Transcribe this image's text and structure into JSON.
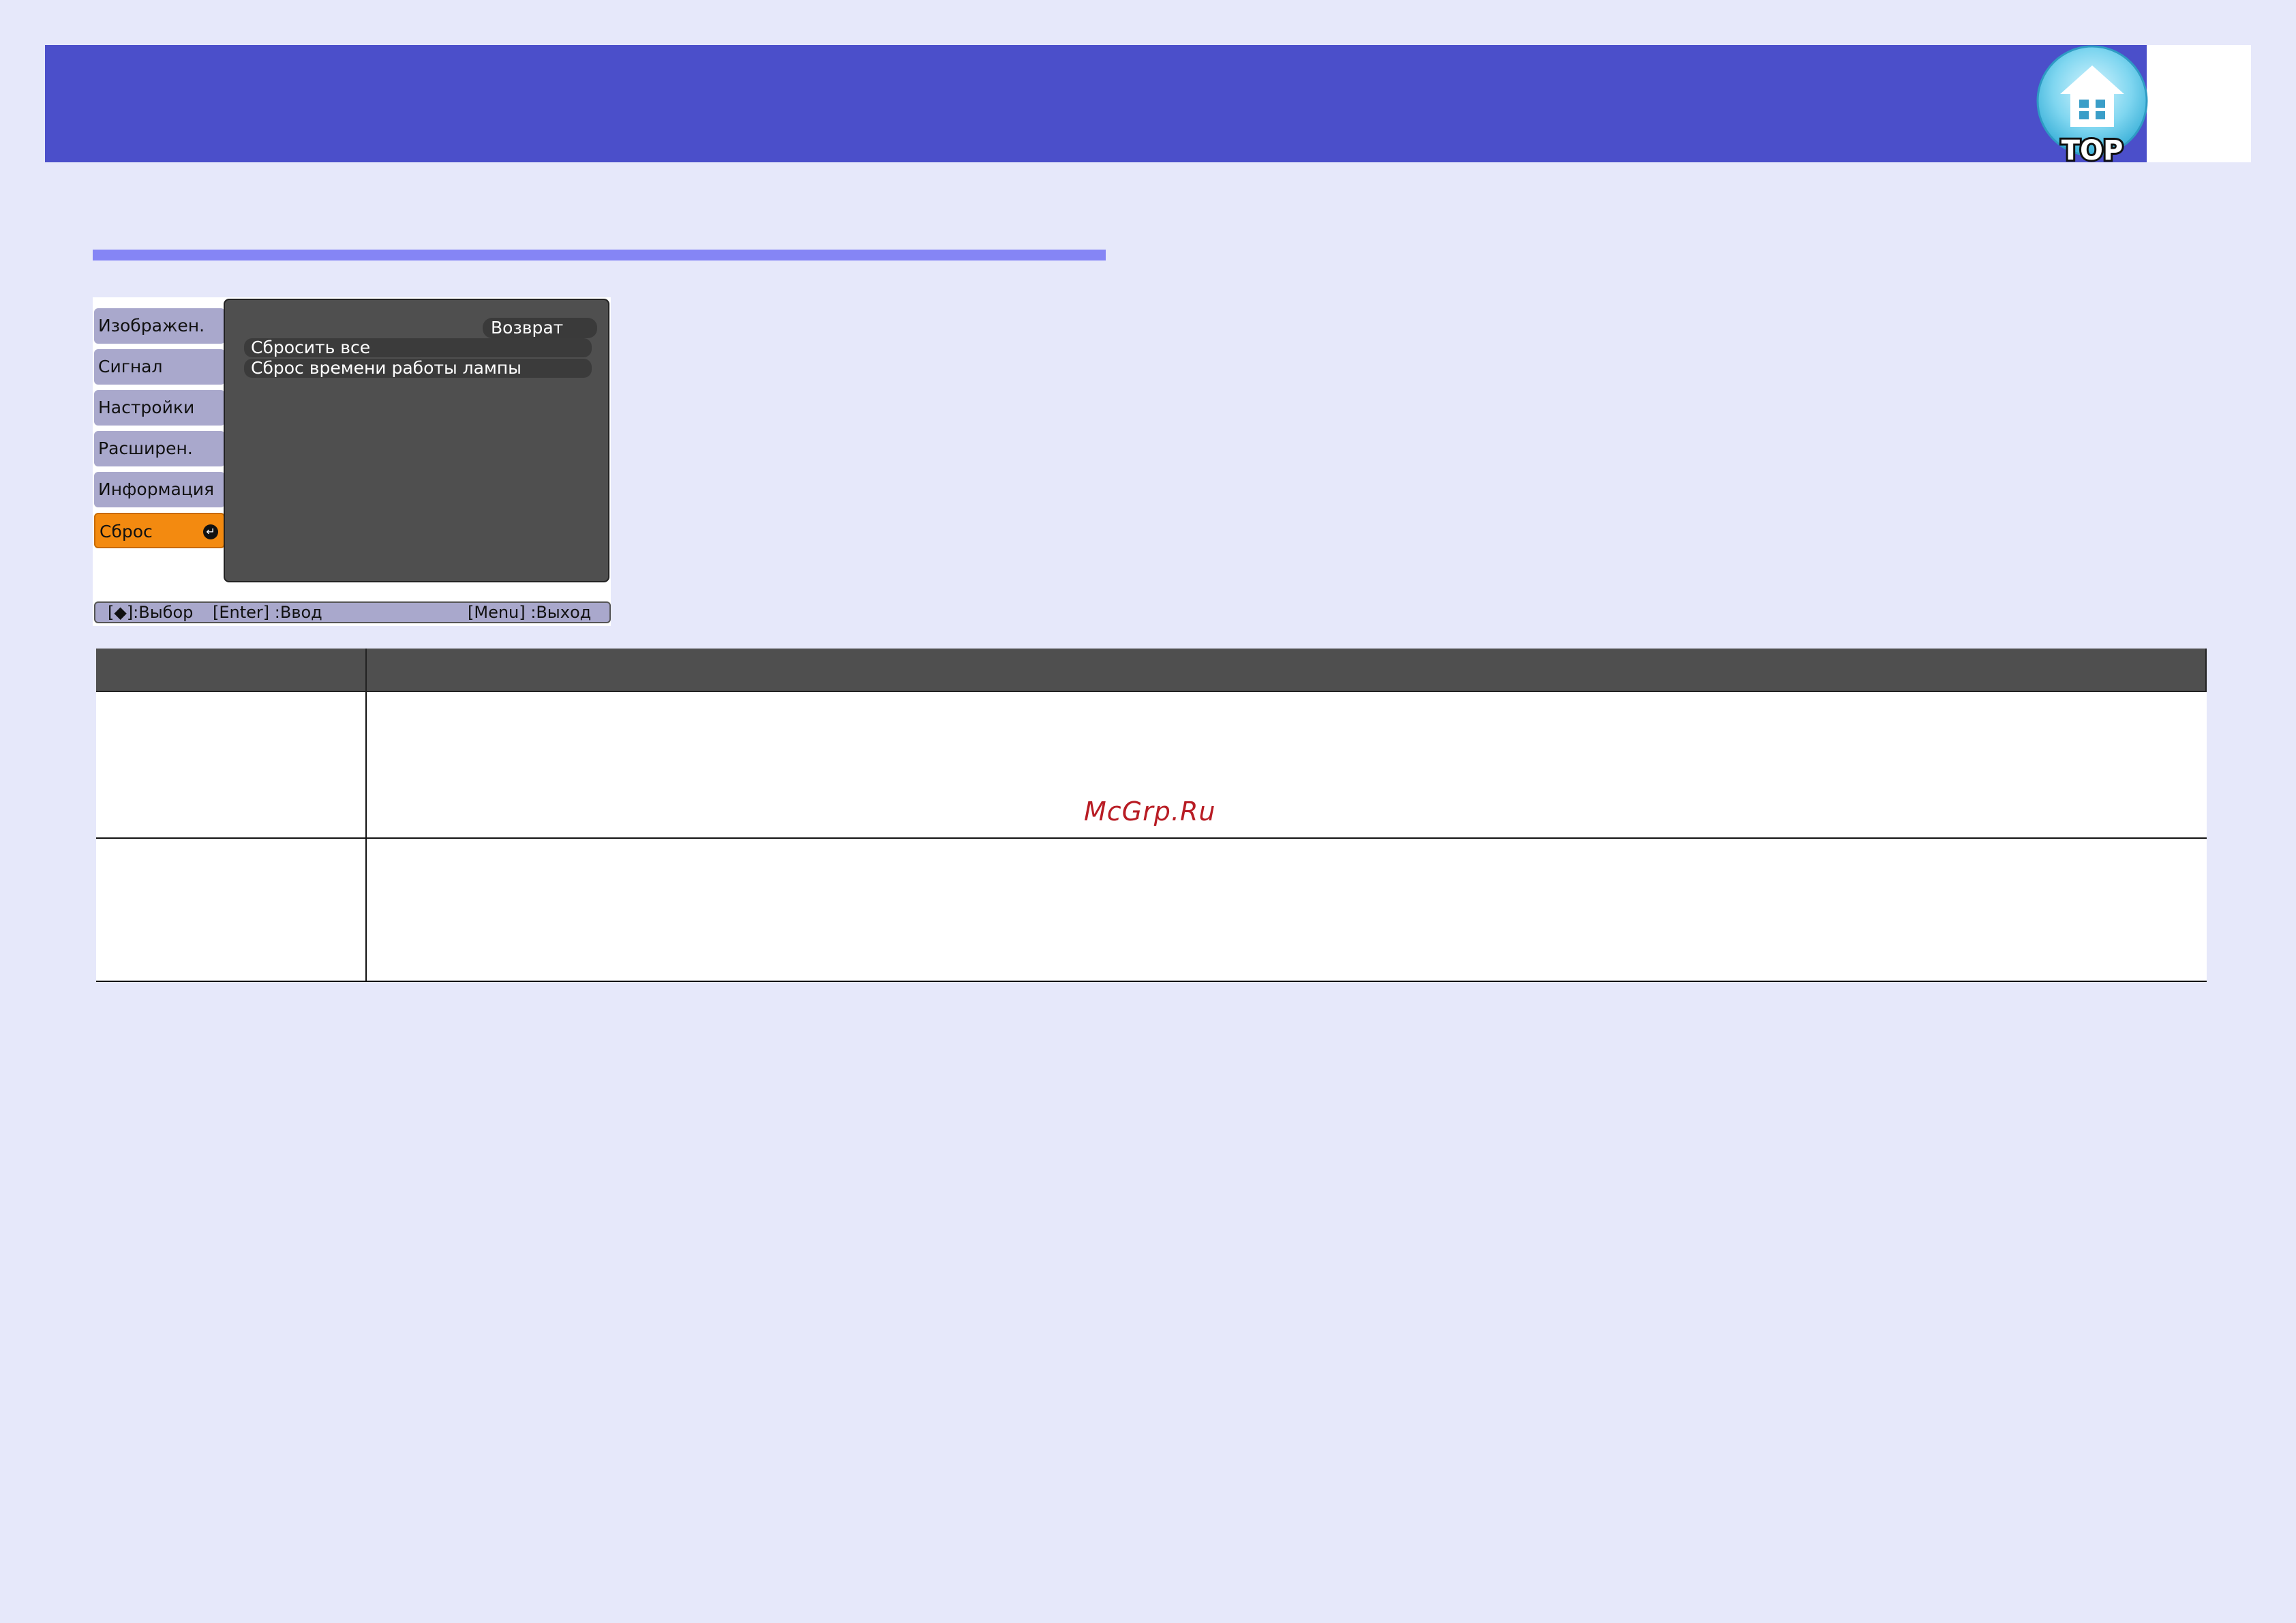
{
  "header": {
    "top_button": {
      "label": "TOP",
      "icon": "home-icon"
    }
  },
  "menu": {
    "tabs": [
      {
        "label": "Изображен.",
        "active": false
      },
      {
        "label": "Сигнал",
        "active": false
      },
      {
        "label": "Настройки",
        "active": false
      },
      {
        "label": "Расширен.",
        "active": false
      },
      {
        "label": "Информация",
        "active": false
      },
      {
        "label": "Сброс",
        "active": true
      }
    ],
    "return_label": "Возврат",
    "items": [
      "Сбросить все",
      "Сброс времени работы лампы"
    ],
    "footer": {
      "select": "[◆]:Выбор",
      "enter": "[Enter] :Ввод",
      "exit": "[Menu] :Выход"
    }
  },
  "table": {
    "headers": [
      "",
      ""
    ],
    "rows": [
      [
        "",
        ""
      ],
      [
        "",
        ""
      ]
    ]
  },
  "watermark": "McGrp.Ru",
  "colors": {
    "page_bg": "#e6e8fa",
    "header_band": "#4b4fca",
    "section_rule": "#8585f5",
    "active_tab": "#f38a10",
    "watermark": "#b81c24"
  }
}
